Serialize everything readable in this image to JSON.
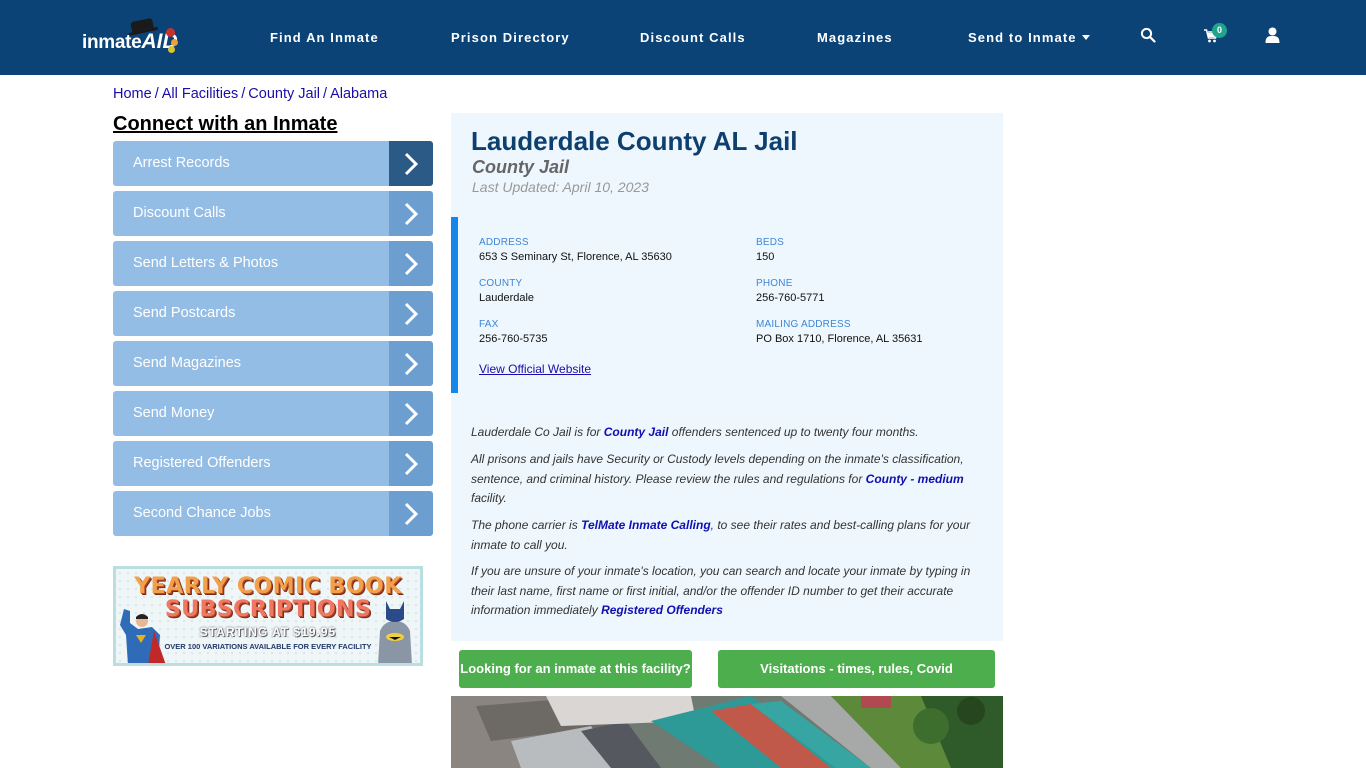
{
  "header": {
    "logo_text": "inmate",
    "logo_accent": "AID",
    "nav": [
      {
        "label": "Find An Inmate"
      },
      {
        "label": "Prison Directory"
      },
      {
        "label": "Discount Calls"
      },
      {
        "label": "Magazines"
      },
      {
        "label": "Send to Inmate",
        "has_dropdown": true
      }
    ],
    "icons": [
      "search-icon",
      "cart-icon",
      "user-icon"
    ],
    "cart_count": "0",
    "colors": {
      "bar": "#0b4377",
      "badge": "#1ea58b"
    }
  },
  "breadcrumb": [
    {
      "label": "Home"
    },
    {
      "label": "All Facilities"
    },
    {
      "label": "County Jail"
    },
    {
      "label": "Alabama"
    }
  ],
  "sidebar": {
    "title": "Connect with an Inmate",
    "items": [
      {
        "label": "Arrest Records",
        "active": true
      },
      {
        "label": "Discount Calls"
      },
      {
        "label": "Send Letters & Photos"
      },
      {
        "label": "Send Postcards"
      },
      {
        "label": "Send Magazines"
      },
      {
        "label": "Send Money"
      },
      {
        "label": "Registered Offenders"
      },
      {
        "label": "Second Chance Jobs"
      }
    ],
    "promo": {
      "line1": "YEARLY COMIC BOOK",
      "line2": "SUBSCRIPTIONS",
      "line3": "STARTING AT $19.95",
      "line4": "OVER 100 VARIATIONS AVAILABLE FOR EVERY FACILITY"
    }
  },
  "facility": {
    "name": "Lauderdale County AL Jail",
    "type": "County Jail",
    "last_updated": "Last Updated: April 10, 2023",
    "fields": {
      "address": {
        "label": "ADDRESS",
        "value": "653 S Seminary St, Florence, AL 35630"
      },
      "beds": {
        "label": "BEDS",
        "value": "150"
      },
      "county": {
        "label": "COUNTY",
        "value": "Lauderdale"
      },
      "phone": {
        "label": "PHONE",
        "value": "256-760-5771"
      },
      "fax": {
        "label": "FAX",
        "value": "256-760-5735"
      },
      "mailing": {
        "label": "MAILING ADDRESS",
        "value": "PO Box 1710, Florence, AL 35631"
      }
    },
    "website_link": "View Official Website",
    "description": {
      "p1": {
        "pre": "Lauderdale Co Jail is for ",
        "link": "County Jail",
        "post": " offenders sentenced up to twenty four months."
      },
      "p2": {
        "pre": "All prisons and jails have Security or Custody levels depending on the inmate's classification, sentence, and criminal history. Please review the rules and regulations for ",
        "link": "County - medium",
        "post": " facility."
      },
      "p3": {
        "pre": "The phone carrier is ",
        "link": "TelMate Inmate Calling",
        "post": ", to see their rates and best-calling plans for your inmate to call you."
      },
      "p4": {
        "pre": "If you are unsure of your inmate's location, you can search and locate your inmate by typing in their last name, first name or first initial, and/or the offender ID number to get their accurate information immediately ",
        "link": "Registered Offenders",
        "post": ""
      }
    },
    "buttons": {
      "find_inmate": "Looking for an inmate at this facility?",
      "visitation": "Visitations - times, rules, Covid cancellations"
    },
    "colors": {
      "title": "#0d3f6f",
      "accent_bar": "#1587ea",
      "green_button": "#4cae4c",
      "panel_bg": "#eef7fd"
    }
  }
}
